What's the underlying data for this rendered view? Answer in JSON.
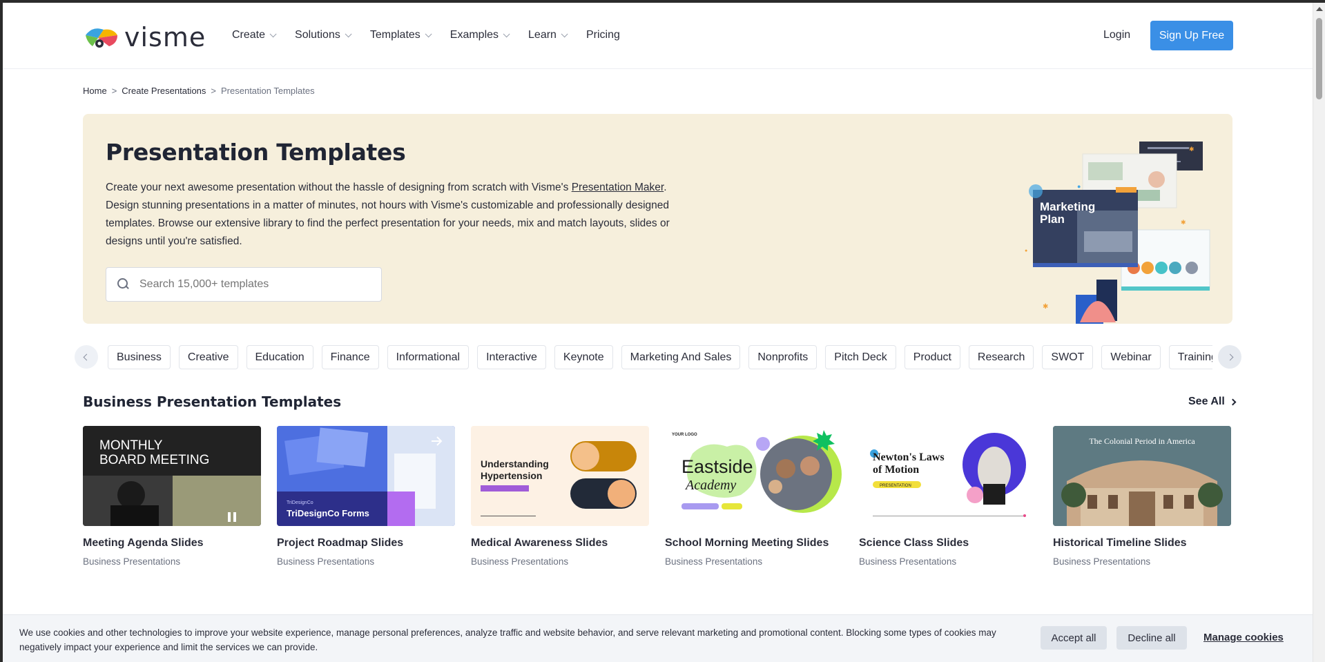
{
  "header": {
    "logo_text": "visme",
    "nav": [
      {
        "label": "Create",
        "has_dropdown": true
      },
      {
        "label": "Solutions",
        "has_dropdown": true
      },
      {
        "label": "Templates",
        "has_dropdown": true
      },
      {
        "label": "Examples",
        "has_dropdown": true
      },
      {
        "label": "Learn",
        "has_dropdown": true
      },
      {
        "label": "Pricing",
        "has_dropdown": false
      }
    ],
    "login_label": "Login",
    "signup_label": "Sign Up Free"
  },
  "breadcrumb": {
    "home": "Home",
    "sep": ">",
    "parent": "Create Presentations",
    "current": "Presentation Templates"
  },
  "hero": {
    "title": "Presentation Templates",
    "desc_part1": "Create your next awesome presentation without the hassle of designing from scratch with Visme's ",
    "desc_link": "Presentation Maker",
    "desc_part2": ". Design stunning presentations in a matter of minutes, not hours with Visme's customizable and professionally designed templates. Browse our extensive library to find the perfect presentation for your needs, mix and match layouts, slides or designs until you're satisfied.",
    "search_placeholder": "Search 15,000+ templates",
    "art": {
      "slide_title_line1": "Marketing",
      "slide_title_line2": "Plan"
    }
  },
  "categories": [
    "Business",
    "Creative",
    "Education",
    "Finance",
    "Informational",
    "Interactive",
    "Keynote",
    "Marketing And Sales",
    "Nonprofits",
    "Pitch Deck",
    "Product",
    "Research",
    "SWOT",
    "Webinar",
    "Training Cou"
  ],
  "section": {
    "title": "Business Presentation Templates",
    "see_all": "See All",
    "cards": [
      {
        "title": "Meeting Agenda Slides",
        "subtitle": "Business Presentations",
        "thumb_text": "MONTHLY\nBOARD MEETING"
      },
      {
        "title": "Project Roadmap Slides",
        "subtitle": "Business Presentations",
        "thumb_text": "TriDesignCo Forms",
        "thumb_brand": "TriDesignCo"
      },
      {
        "title": "Medical Awareness Slides",
        "subtitle": "Business Presentations",
        "thumb_text": "Understanding Hypertension"
      },
      {
        "title": "School Morning Meeting Slides",
        "subtitle": "Business Presentations",
        "thumb_text": "Eastside",
        "thumb_text2": "Academy",
        "thumb_logo": "YOUR LOGO"
      },
      {
        "title": "Science Class Slides",
        "subtitle": "Business Presentations",
        "thumb_text": "Newton's Laws of Motion",
        "thumb_badge": "PRESENTATION"
      },
      {
        "title": "Historical Timeline Slides",
        "subtitle": "Business Presentations",
        "thumb_text": "The Colonial Period in America"
      }
    ]
  },
  "cookie": {
    "text": "We use cookies and other technologies to improve your website experience, manage personal preferences, analyze traffic and website behavior, and serve relevant marketing and promotional content. Blocking some types of cookies may negatively impact your experience and limit the services we can provide.",
    "accept": "Accept all",
    "decline": "Decline all",
    "manage": "Manage cookies"
  },
  "colors": {
    "accent": "#3a8fe6",
    "hero_bg": "#f6efdc",
    "text": "#2b2d3a"
  }
}
